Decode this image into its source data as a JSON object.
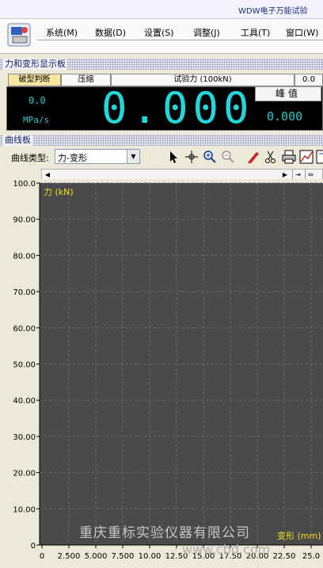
{
  "window": {
    "title": "WDW电子万能试验"
  },
  "menu": {
    "items": [
      "系统(M)",
      "数据(D)",
      "设置(S)",
      "调整(J)",
      "工具(T)",
      "窗口(W)"
    ]
  },
  "force_panel": {
    "title": "力和变形显示板",
    "tabs": {
      "judge": "破型判断",
      "compress": "压缩",
      "force": "试验力 (100kN)",
      "corner": "0.0"
    },
    "rate_value": "0.0",
    "rate_unit": "MPa/s",
    "main_value": "0.000",
    "peak_label": "峰值",
    "peak_value": "0.000"
  },
  "curve_panel": {
    "title": "曲线板",
    "type_label": "曲线类型:",
    "type_value": "力-变形",
    "tools": [
      "pointer-icon",
      "crosshair-icon",
      "zoom-in-icon",
      "zoom-out-icon",
      "pen-icon",
      "scissors-icon",
      "printer-icon",
      "chart-icon",
      "settings-icon"
    ]
  },
  "chart_data": {
    "type": "line",
    "ylabel": "力 (kN)",
    "xlabel": "变形 (mm)",
    "ylim": [
      0,
      100
    ],
    "xlim": [
      0,
      25
    ],
    "y_ticks": [
      "0",
      "10.00",
      "20.00",
      "30.00",
      "40.00",
      "50.00",
      "60.00",
      "70.00",
      "80.00",
      "90.00",
      "100.0"
    ],
    "x_ticks": [
      "0",
      "2.500",
      "5.000",
      "7.500",
      "10.00",
      "12.50",
      "15.00",
      "17.50",
      "20.00",
      "22.50",
      "25.0"
    ],
    "series": [],
    "grid": true,
    "colors": {
      "plot_bg": "#4a4a4a",
      "grid": "#6a6a6a",
      "label": "#f0e020"
    }
  },
  "watermark": {
    "company": "重庆重标实验仪器有限公司",
    "url": "www.cbd.com"
  }
}
